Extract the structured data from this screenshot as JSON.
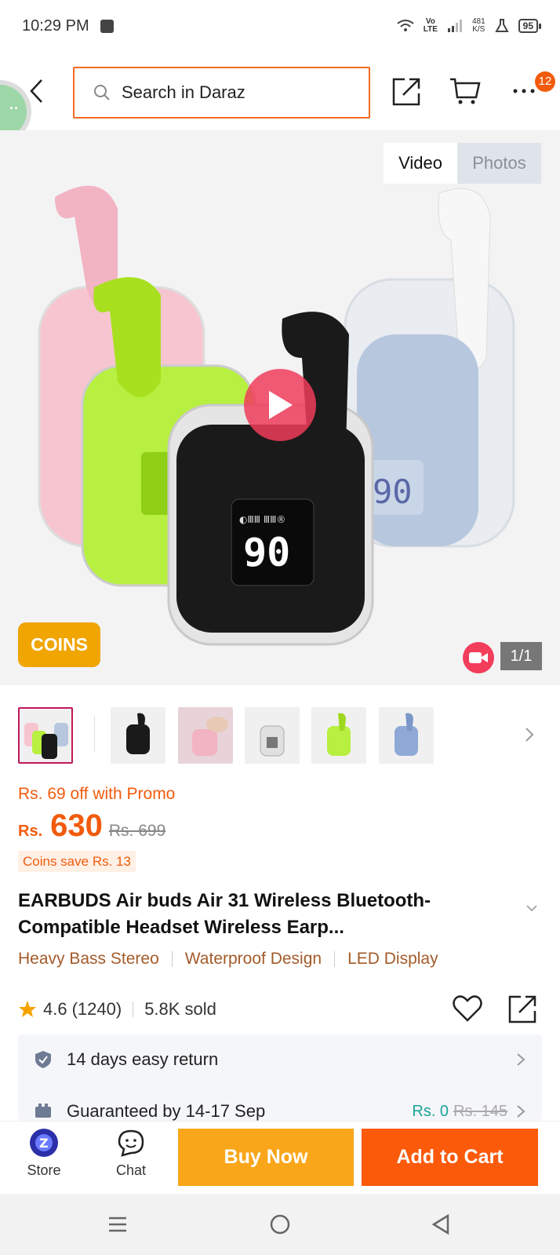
{
  "status_bar": {
    "time": "10:29 PM",
    "network_top": "Vo",
    "network_bottom": "LTE",
    "speed_value": "481",
    "speed_unit": "K/S",
    "battery": "95"
  },
  "header": {
    "search_placeholder": "Search in Daraz",
    "more_badge": "12",
    "accent_color": "#f06b22"
  },
  "media": {
    "tabs": [
      {
        "label": "Video"
      },
      {
        "label": "Photos"
      }
    ],
    "coins_label": "COINS",
    "counter": "1/1"
  },
  "thumbnails": {
    "count": 6,
    "selected_index": 0
  },
  "price": {
    "promo": "Rs. 69 off with Promo",
    "currency": "Rs.",
    "amount": "630",
    "original": "Rs. 699",
    "coins_save": "Coins save Rs. 13",
    "color": "#f25b0c"
  },
  "product": {
    "title": "EARBUDS Air buds Air 31 Wireless Bluetooth-Compatible Headset Wireless Earp...",
    "features": [
      "Heavy Bass Stereo",
      "Waterproof Design",
      "LED Display"
    ]
  },
  "rating": {
    "score": "4.6",
    "count": "(1240)",
    "sold": "5.8K sold"
  },
  "info": {
    "return_label": "14 days easy return",
    "delivery_label": "Guaranteed by 14-17 Sep",
    "delivery_price": "Rs. 0",
    "delivery_old_price": "Rs. 145"
  },
  "action_bar": {
    "store_label": "Store",
    "chat_label": "Chat",
    "buy_now_label": "Buy Now",
    "add_to_cart_label": "Add to Cart"
  }
}
